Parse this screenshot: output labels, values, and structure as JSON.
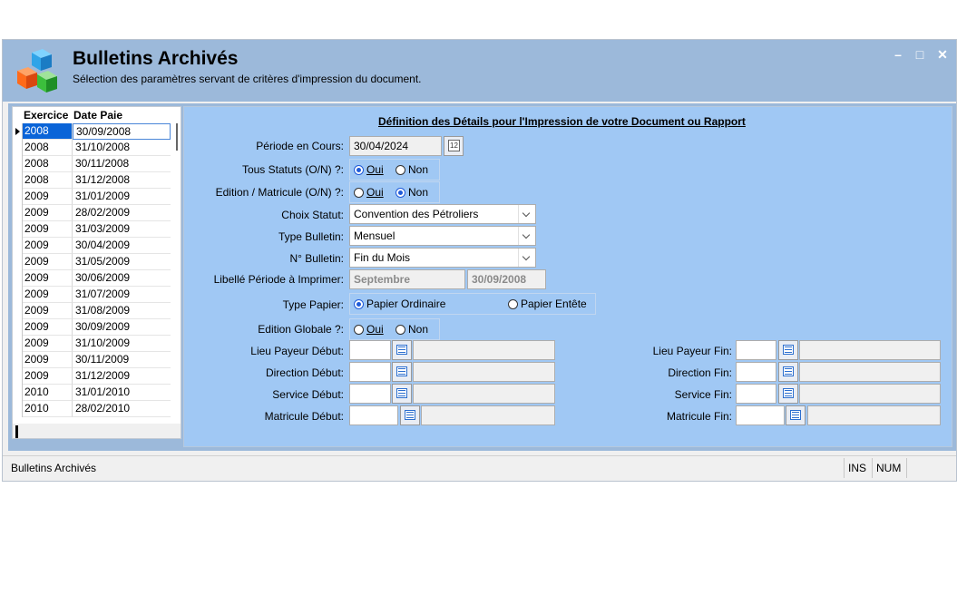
{
  "window": {
    "title": "Bulletins Archivés",
    "subtitle": "Sélection des paramètres servant de critères d'impression du document.",
    "controls": {
      "minimize": "–",
      "maximize": "□",
      "close": "✕"
    }
  },
  "grid": {
    "headers": [
      "Exercice",
      "Date Paie"
    ],
    "rows": [
      [
        "2008",
        "30/09/2008"
      ],
      [
        "2008",
        "31/10/2008"
      ],
      [
        "2008",
        "30/11/2008"
      ],
      [
        "2008",
        "31/12/2008"
      ],
      [
        "2009",
        "31/01/2009"
      ],
      [
        "2009",
        "28/02/2009"
      ],
      [
        "2009",
        "31/03/2009"
      ],
      [
        "2009",
        "30/04/2009"
      ],
      [
        "2009",
        "31/05/2009"
      ],
      [
        "2009",
        "30/06/2009"
      ],
      [
        "2009",
        "31/07/2009"
      ],
      [
        "2009",
        "31/08/2009"
      ],
      [
        "2009",
        "30/09/2009"
      ],
      [
        "2009",
        "31/10/2009"
      ],
      [
        "2009",
        "30/11/2009"
      ],
      [
        "2009",
        "31/12/2009"
      ],
      [
        "2010",
        "31/01/2010"
      ],
      [
        "2010",
        "28/02/2010"
      ]
    ]
  },
  "form": {
    "section_title": "Définition des Détails pour l'Impression de votre Document ou Rapport",
    "periode": {
      "label": "Période en Cours:",
      "value": "30/04/2024",
      "cal_text": "12"
    },
    "tous_statuts": {
      "label": "Tous Statuts (O/N) ?:",
      "oui": "Oui",
      "non": "Non",
      "selected": "Oui"
    },
    "edition_matricule": {
      "label": "Edition / Matricule (O/N) ?:",
      "oui": "Oui",
      "non": "Non",
      "selected": "Non"
    },
    "choix_statut": {
      "label": "Choix Statut:",
      "value": "Convention des Pétroliers"
    },
    "type_bulletin": {
      "label": "Type Bulletin:",
      "value": "Mensuel"
    },
    "no_bulletin": {
      "label": "N° Bulletin:",
      "value": "Fin du Mois"
    },
    "libelle_periode": {
      "label": "Libellé Période à Imprimer:",
      "value1": "Septembre",
      "value2": "30/09/2008"
    },
    "type_papier": {
      "label": "Type Papier:",
      "opt1": "Papier Ordinaire",
      "opt2": "Papier Entête",
      "selected": "Papier Ordinaire"
    },
    "edition_globale": {
      "label": "Edition Globale ?:",
      "oui": "Oui",
      "non": "Non",
      "selected": "Non"
    },
    "lieu_payeur_debut": {
      "label": "Lieu Payeur Début:"
    },
    "direction_debut": {
      "label": "Direction Début:"
    },
    "service_debut": {
      "label": "Service Début:"
    },
    "matricule_debut": {
      "label": "Matricule Début:"
    },
    "lieu_payeur_fin": {
      "label": "Lieu Payeur Fin:"
    },
    "direction_fin": {
      "label": "Direction Fin:"
    },
    "service_fin": {
      "label": "Service Fin:"
    },
    "matricule_fin": {
      "label": "Matricule Fin:"
    }
  },
  "statusbar": {
    "text": "Bulletins Archivés",
    "ins": "INS",
    "num": "NUM"
  },
  "colors": {
    "header_bg": "#9cb9da",
    "pane_bg": "#a0c8f4",
    "selection": "#0a64d8"
  }
}
